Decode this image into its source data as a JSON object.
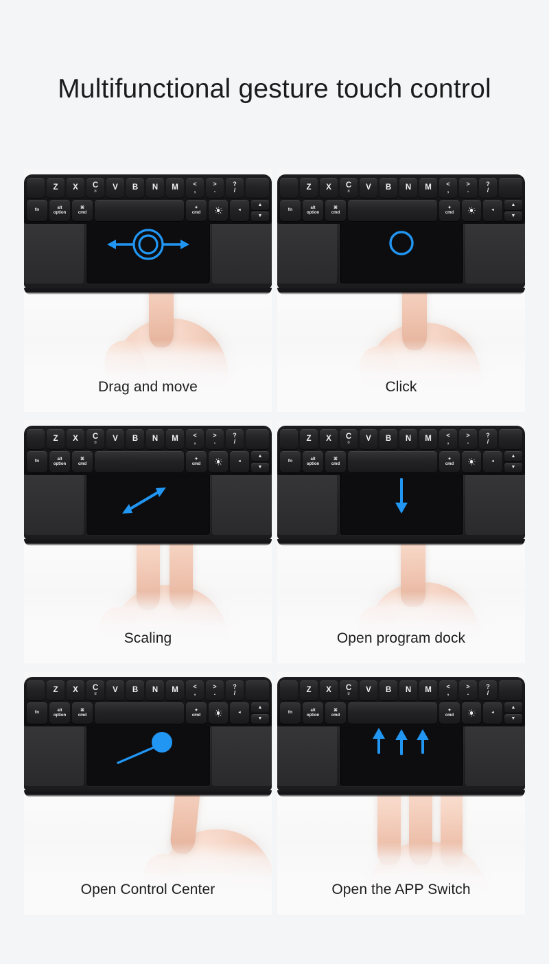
{
  "page": {
    "title": "Multifunctional gesture touch control",
    "background_color": "#f4f5f7",
    "accent_color": "#2196f3",
    "text_color": "#1b1b1b"
  },
  "keyboard": {
    "row_letters": [
      {
        "main": "Z"
      },
      {
        "main": "X"
      },
      {
        "main": "C",
        "sub": "8"
      },
      {
        "main": "V"
      },
      {
        "main": "B"
      },
      {
        "main": "N"
      },
      {
        "main": "M"
      },
      {
        "top": "<",
        "bot": ","
      },
      {
        "top": ">",
        "bot": "."
      },
      {
        "top": "?",
        "bot": "/"
      }
    ],
    "row_bottom": {
      "fn": "fn",
      "alt_top": "alt",
      "alt_bottom": "option",
      "cmd_symbol": "⌘",
      "cmd_label": "cmd",
      "space": "",
      "cmd_right_label": "cmd",
      "brightness_icon": "sun-icon",
      "left_arrow": "◂",
      "up_arrow": "▲",
      "down_arrow": "▼"
    }
  },
  "panels": [
    {
      "id": "drag-and-move",
      "caption": "Drag and move",
      "gesture": "one-finger-drag-horizontal",
      "fingers": 1,
      "overlay": "concentric-rings-with-left-right-arrows"
    },
    {
      "id": "click",
      "caption": "Click",
      "gesture": "one-finger-tap",
      "fingers": 1,
      "overlay": "single-ring"
    },
    {
      "id": "scaling",
      "caption": "Scaling",
      "gesture": "two-finger-pinch",
      "fingers": 2,
      "overlay": "diagonal-double-arrow"
    },
    {
      "id": "open-program-dock",
      "caption": "Open program dock",
      "gesture": "one-finger-swipe-down",
      "fingers": 1,
      "overlay": "down-arrow"
    },
    {
      "id": "open-control-center",
      "caption": "Open Control Center",
      "gesture": "one-finger-swipe-diagonal",
      "fingers": 1,
      "overlay": "filled-dot-with-tail"
    },
    {
      "id": "open-the-app-switch",
      "caption": "Open the APP Switch",
      "gesture": "three-finger-swipe-up",
      "fingers": 3,
      "overlay": "three-up-arrows"
    }
  ]
}
